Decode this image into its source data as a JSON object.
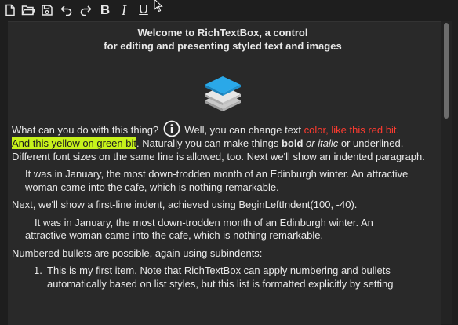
{
  "toolbar": {
    "buttons": [
      {
        "name": "new-document-icon"
      },
      {
        "name": "open-folder-icon"
      },
      {
        "name": "save-icon"
      },
      {
        "name": "undo-icon"
      },
      {
        "name": "redo-icon"
      },
      {
        "name": "bold-icon",
        "glyph": "B"
      },
      {
        "name": "italic-icon",
        "glyph": "I"
      },
      {
        "name": "underline-icon",
        "glyph": "U"
      }
    ]
  },
  "document": {
    "title_line1": "Welcome to RichTextBox, a control",
    "title_line2": "for editing and presenting styled text and images",
    "p1": {
      "lead": "What can you do with this thing?",
      "after_icon": "Well, you can change text",
      "red_text": "color, like this red bit.",
      "highlight_text": "And this yellow on green bit",
      "mid": ". Naturally you can make things",
      "bold": "bold",
      "italic": "or italic",
      "underlined": "or underlined.",
      "tail": "Different font sizes on the same line is allowed, too. Next we'll show an indented paragraph."
    },
    "p2": "It was in January, the most down-trodden month of an Edinburgh winter. An attractive woman came into the cafe, which is nothing remarkable.",
    "p3": "Next, we'll show a first-line indent, achieved using BeginLeftIndent(100, -40).",
    "p4_line1": "It was in January, the most down-trodden month of an Edinburgh winter. An",
    "p4_line2": "attractive woman came into the cafe, which is nothing remarkable.",
    "p5": "Numbered bullets are possible, again using subindents:",
    "list_item1_number": "1.",
    "list_item1_line1": "This is my first item. Note that RichTextBox can apply numbering and bullets",
    "list_item1_line2": "automatically based on list styles, but this list is formatted explicitly by setting"
  },
  "colors": {
    "background": "#1e1e1e",
    "editor_background": "#292929",
    "text": "#e8e8e8",
    "red_text": "#ff3b30",
    "highlight": "#c6f21b",
    "logo_blue": "#2aa8e8"
  }
}
